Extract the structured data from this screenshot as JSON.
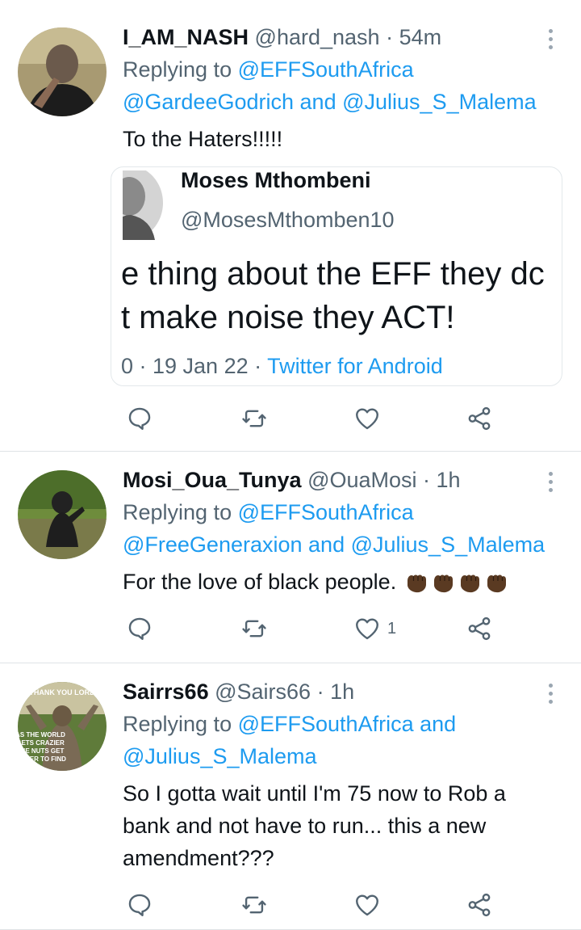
{
  "tweets": [
    {
      "name": "I_AM_NASH",
      "handle": "@hard_nash",
      "time": "· 54m",
      "reply_prefix": "Replying to",
      "reply_line1": "@EFFSouthAfrica",
      "reply_line2_a": "@GardeeGodrich",
      "reply_line2_and": "and",
      "reply_line2_b": "@Julius_S_Malema",
      "text": "To the Haters!!!!!",
      "quote": {
        "name": "Moses Mthombeni",
        "handle": "@MosesMthomben10",
        "line1": "e thing about the EFF they dc",
        "line2": "t make noise they ACT!",
        "meta_prefix": "0 · 19 Jan 22 ·",
        "meta_source": "Twitter for Android"
      },
      "likes": ""
    },
    {
      "name": "Mosi_Oua_Tunya",
      "handle": "@OuaMosi",
      "time": "· 1h",
      "reply_prefix": "Replying to",
      "reply_line1": "@EFFSouthAfrica",
      "reply_line2_a": "@FreeGeneraxion",
      "reply_line2_and": "and",
      "reply_line2_b": "@Julius_S_Malema",
      "text": "For the love of black people.",
      "likes": "1"
    },
    {
      "name": "Sairrs66",
      "handle": "@Sairs66",
      "time": "· 1h",
      "reply_prefix": "Replying to",
      "reply_line1": "@EFFSouthAfrica",
      "reply_line1_and": "and",
      "reply_line2": "@Julius_S_Malema",
      "text_line1": "So I gotta wait until I'm 75 now to Rob a",
      "text_line2": "bank and not have to run... this a new",
      "text_line3": "amendment???",
      "avatar_text": {
        "top": "THANK YOU LORD",
        "l1": "AS THE WORLD",
        "l2": "GETS CRAZIER",
        "l3": "THE NUTS GET",
        "l4": "EASIER TO FIND"
      },
      "likes": ""
    }
  ],
  "icons": [
    "reply-icon",
    "retweet-icon",
    "like-icon",
    "share-icon",
    "more-icon",
    "raised-fist-emoji"
  ],
  "colors": {
    "link": "#1d9bf0",
    "muted": "#536471",
    "divider": "#dfe3e6"
  }
}
